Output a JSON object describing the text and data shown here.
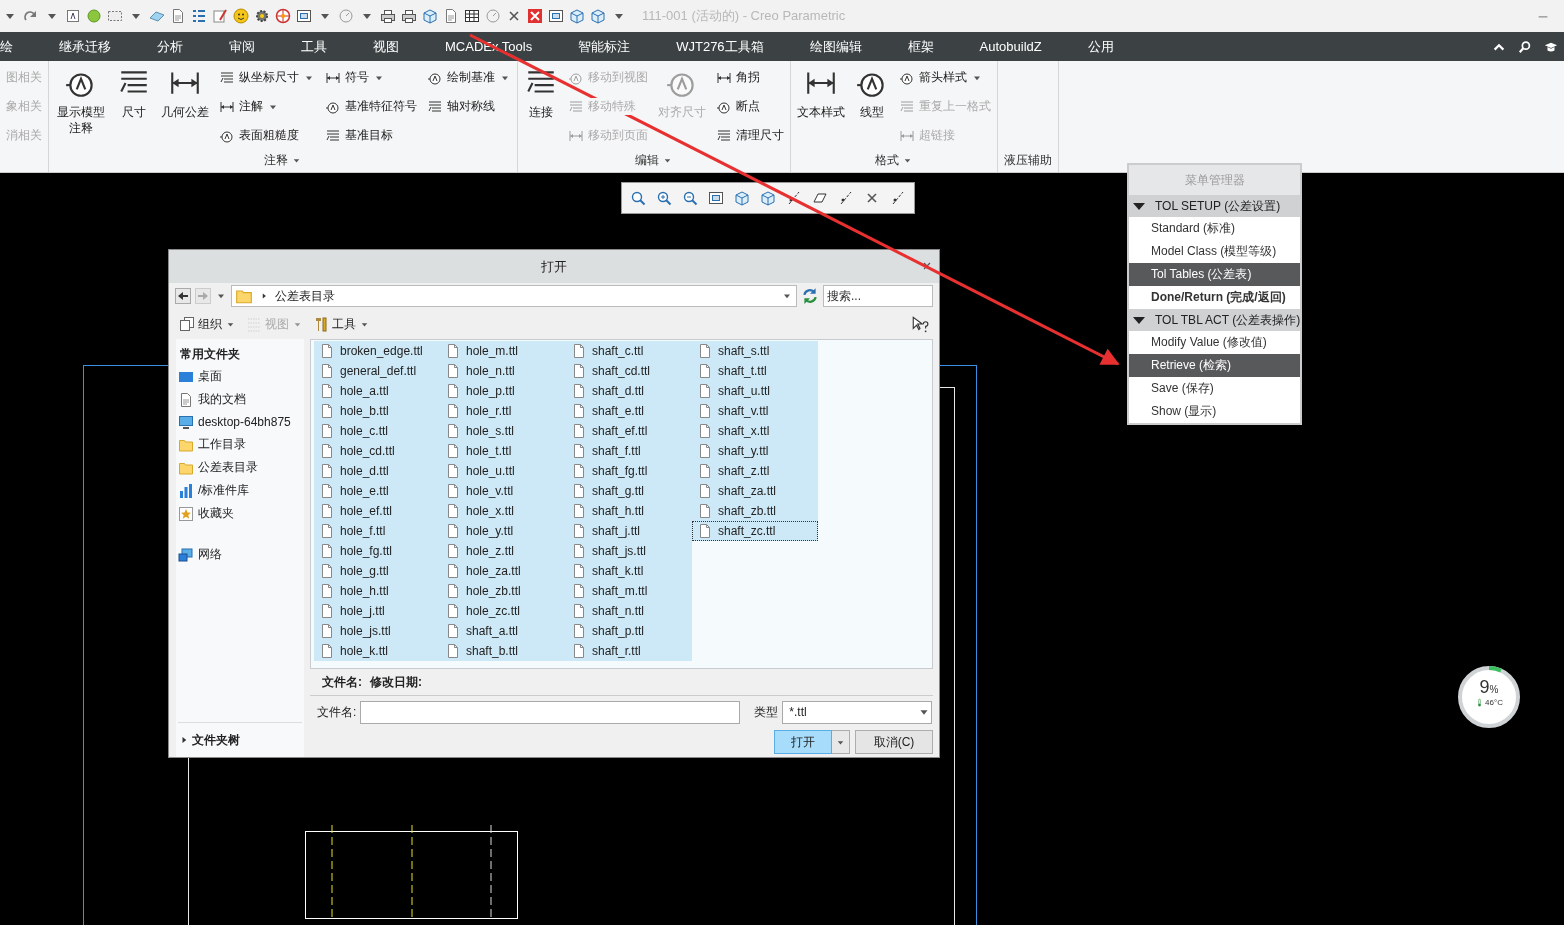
{
  "quick_access": {
    "title": "111-001 (活动的) - Creo Parametric"
  },
  "menu_tabs": [
    {
      "label": "绘"
    },
    {
      "label": "继承迁移"
    },
    {
      "label": "分析"
    },
    {
      "label": "审阅"
    },
    {
      "label": "工具"
    },
    {
      "label": "视图"
    },
    {
      "label": "MCADEx Tools"
    },
    {
      "label": "智能标注"
    },
    {
      "label": "WJT276工具箱"
    },
    {
      "label": "绘图编辑"
    },
    {
      "label": "框架"
    },
    {
      "label": "AutobuildZ"
    },
    {
      "label": "公用"
    }
  ],
  "ribbon": [
    {
      "columns": [
        {
          "kind": "text",
          "items": [
            {
              "label": "图相关",
              "disabled": true,
              "dropdown": false
            },
            {
              "label": "象相关",
              "disabled": true,
              "dropdown": false
            },
            {
              "label": "消相关",
              "disabled": true,
              "dropdown": false
            }
          ]
        }
      ]
    },
    {
      "title": "注释",
      "title_dropdown": true,
      "columns": [
        {
          "kind": "large",
          "items": [
            {
              "label": "显示模型注释",
              "disabled": false,
              "dropdown": false
            }
          ]
        },
        {
          "kind": "large",
          "items": [
            {
              "label": "尺寸",
              "disabled": false,
              "dropdown": false
            },
            {
              "label": "几何公差",
              "disabled": false,
              "dropdown": false
            }
          ]
        },
        {
          "kind": "stack",
          "items": [
            {
              "label": "纵坐标尺寸",
              "disabled": false,
              "dropdown": true
            },
            {
              "label": "注解",
              "disabled": false,
              "dropdown": true
            },
            {
              "label": "表面粗糙度",
              "disabled": false,
              "dropdown": false
            }
          ]
        },
        {
          "kind": "stack",
          "items": [
            {
              "label": "符号",
              "disabled": false,
              "dropdown": true
            },
            {
              "label": "基准特征符号",
              "disabled": false,
              "dropdown": false
            },
            {
              "label": "基准目标",
              "disabled": false,
              "dropdown": false
            }
          ]
        },
        {
          "kind": "stack",
          "items": [
            {
              "label": "绘制基准",
              "disabled": false,
              "dropdown": true
            },
            {
              "label": "轴对称线",
              "disabled": false,
              "dropdown": false
            }
          ]
        }
      ]
    },
    {
      "title": "编辑",
      "title_dropdown": true,
      "columns": [
        {
          "kind": "large",
          "items": [
            {
              "label": "连接",
              "disabled": false,
              "dropdown": false
            }
          ]
        },
        {
          "kind": "stack",
          "items": [
            {
              "label": "移动到视图",
              "disabled": true,
              "dropdown": false
            },
            {
              "label": "移动特殊",
              "disabled": true,
              "dropdown": false
            },
            {
              "label": "移动到页面",
              "disabled": true,
              "dropdown": false
            }
          ]
        },
        {
          "kind": "large",
          "items": [
            {
              "label": "对齐尺寸",
              "disabled": true,
              "dropdown": false
            }
          ]
        },
        {
          "kind": "stack",
          "items": [
            {
              "label": "角拐",
              "disabled": false,
              "dropdown": false
            },
            {
              "label": "断点",
              "disabled": false,
              "dropdown": false
            },
            {
              "label": "清理尺寸",
              "disabled": false,
              "dropdown": false
            }
          ]
        }
      ]
    },
    {
      "title": "格式",
      "title_dropdown": true,
      "columns": [
        {
          "kind": "large",
          "items": [
            {
              "label": "文本样式",
              "disabled": false,
              "dropdown": false
            },
            {
              "label": "线型",
              "disabled": false,
              "dropdown": false
            }
          ]
        },
        {
          "kind": "stack",
          "items": [
            {
              "label": "箭头样式",
              "disabled": false,
              "dropdown": true
            },
            {
              "label": "重复上一格式",
              "disabled": true,
              "dropdown": false
            },
            {
              "label": "超链接",
              "disabled": true,
              "dropdown": false
            }
          ]
        }
      ]
    },
    {
      "title": "液压辅助",
      "title_dropdown": false
    }
  ],
  "menu_manager": {
    "title": "菜单管理器",
    "sections": [
      {
        "label": "TOL SETUP (公差设置)",
        "expanded": true,
        "items": [
          {
            "label": "Standard (标准)",
            "selected": false,
            "bold": false
          },
          {
            "label": "Model Class (模型等级)",
            "selected": false,
            "bold": false
          },
          {
            "label": "Tol Tables (公差表)",
            "selected": true,
            "bold": false
          },
          {
            "label": "Done/Return (完成/返回)",
            "selected": false,
            "bold": true
          }
        ]
      },
      {
        "label": "TOL TBL ACT (公差表操作)",
        "expanded": true,
        "items": [
          {
            "label": "Modify Value (修改值)",
            "selected": false,
            "bold": false
          },
          {
            "label": "Retrieve (检索)",
            "selected": true,
            "bold": false
          },
          {
            "label": "Save (保存)",
            "selected": false,
            "bold": false
          },
          {
            "label": "Show (显示)",
            "selected": false,
            "bold": false
          }
        ]
      }
    ]
  },
  "dialog": {
    "title": "打开",
    "address": "公差表目录",
    "search": {
      "placeholder": "搜索..."
    },
    "toolbar": [
      {
        "label": "组织",
        "disabled": false
      },
      {
        "label": "视图",
        "disabled": true
      },
      {
        "label": "工具",
        "disabled": false
      }
    ],
    "sidebar": {
      "header": "常用文件夹",
      "groups": [
        [
          {
            "label": "桌面"
          },
          {
            "label": "我的文档"
          },
          {
            "label": "desktop-64bh875"
          },
          {
            "label": "工作目录"
          },
          {
            "label": "公差表目录"
          },
          {
            "label": "/标准件库"
          },
          {
            "label": "收藏夹"
          }
        ],
        [
          {
            "label": "网络"
          }
        ]
      ],
      "footer": "文件夹树"
    },
    "files": [
      {
        "name": "broken_edge.ttl",
        "selected": true,
        "focused": false
      },
      {
        "name": "general_def.ttl",
        "selected": true,
        "focused": false
      },
      {
        "name": "hole_a.ttl",
        "selected": true,
        "focused": false
      },
      {
        "name": "hole_b.ttl",
        "selected": true,
        "focused": false
      },
      {
        "name": "hole_c.ttl",
        "selected": true,
        "focused": false
      },
      {
        "name": "hole_cd.ttl",
        "selected": true,
        "focused": false
      },
      {
        "name": "hole_d.ttl",
        "selected": true,
        "focused": false
      },
      {
        "name": "hole_e.ttl",
        "selected": true,
        "focused": false
      },
      {
        "name": "hole_ef.ttl",
        "selected": true,
        "focused": false
      },
      {
        "name": "hole_f.ttl",
        "selected": true,
        "focused": false
      },
      {
        "name": "hole_fg.ttl",
        "selected": true,
        "focused": false
      },
      {
        "name": "hole_g.ttl",
        "selected": true,
        "focused": false
      },
      {
        "name": "hole_h.ttl",
        "selected": true,
        "focused": false
      },
      {
        "name": "hole_j.ttl",
        "selected": true,
        "focused": false
      },
      {
        "name": "hole_js.ttl",
        "selected": true,
        "focused": false
      },
      {
        "name": "hole_k.ttl",
        "selected": true,
        "focused": false
      },
      {
        "name": "hole_m.ttl",
        "selected": true,
        "focused": false
      },
      {
        "name": "hole_n.ttl",
        "selected": true,
        "focused": false
      },
      {
        "name": "hole_p.ttl",
        "selected": true,
        "focused": false
      },
      {
        "name": "hole_r.ttl",
        "selected": true,
        "focused": false
      },
      {
        "name": "hole_s.ttl",
        "selected": true,
        "focused": false
      },
      {
        "name": "hole_t.ttl",
        "selected": true,
        "focused": false
      },
      {
        "name": "hole_u.ttl",
        "selected": true,
        "focused": false
      },
      {
        "name": "hole_v.ttl",
        "selected": true,
        "focused": false
      },
      {
        "name": "hole_x.ttl",
        "selected": true,
        "focused": false
      },
      {
        "name": "hole_y.ttl",
        "selected": true,
        "focused": false
      },
      {
        "name": "hole_z.ttl",
        "selected": true,
        "focused": false
      },
      {
        "name": "hole_za.ttl",
        "selected": true,
        "focused": false
      },
      {
        "name": "hole_zb.ttl",
        "selected": true,
        "focused": false
      },
      {
        "name": "hole_zc.ttl",
        "selected": true,
        "focused": false
      },
      {
        "name": "shaft_a.ttl",
        "selected": true,
        "focused": false
      },
      {
        "name": "shaft_b.ttl",
        "selected": true,
        "focused": false
      },
      {
        "name": "shaft_c.ttl",
        "selected": true,
        "focused": false
      },
      {
        "name": "shaft_cd.ttl",
        "selected": true,
        "focused": false
      },
      {
        "name": "shaft_d.ttl",
        "selected": true,
        "focused": false
      },
      {
        "name": "shaft_e.ttl",
        "selected": true,
        "focused": false
      },
      {
        "name": "shaft_ef.ttl",
        "selected": true,
        "focused": false
      },
      {
        "name": "shaft_f.ttl",
        "selected": true,
        "focused": false
      },
      {
        "name": "shaft_fg.ttl",
        "selected": true,
        "focused": false
      },
      {
        "name": "shaft_g.ttl",
        "selected": true,
        "focused": false
      },
      {
        "name": "shaft_h.ttl",
        "selected": true,
        "focused": false
      },
      {
        "name": "shaft_j.ttl",
        "selected": true,
        "focused": false
      },
      {
        "name": "shaft_js.ttl",
        "selected": true,
        "focused": false
      },
      {
        "name": "shaft_k.ttl",
        "selected": true,
        "focused": false
      },
      {
        "name": "shaft_m.ttl",
        "selected": true,
        "focused": false
      },
      {
        "name": "shaft_n.ttl",
        "selected": true,
        "focused": false
      },
      {
        "name": "shaft_p.ttl",
        "selected": true,
        "focused": false
      },
      {
        "name": "shaft_r.ttl",
        "selected": true,
        "focused": false
      },
      {
        "name": "shaft_s.ttl",
        "selected": true,
        "focused": false
      },
      {
        "name": "shaft_t.ttl",
        "selected": true,
        "focused": false
      },
      {
        "name": "shaft_u.ttl",
        "selected": true,
        "focused": false
      },
      {
        "name": "shaft_v.ttl",
        "selected": true,
        "focused": false
      },
      {
        "name": "shaft_x.ttl",
        "selected": true,
        "focused": false
      },
      {
        "name": "shaft_y.ttl",
        "selected": true,
        "focused": false
      },
      {
        "name": "shaft_z.ttl",
        "selected": true,
        "focused": false
      },
      {
        "name": "shaft_za.ttl",
        "selected": true,
        "focused": false
      },
      {
        "name": "shaft_zb.ttl",
        "selected": true,
        "focused": false
      },
      {
        "name": "shaft_zc.ttl",
        "selected": true,
        "focused": true
      }
    ],
    "details": {
      "name_label": "文件名:",
      "date_label": "修改日期:"
    },
    "filename": {
      "label": "文件名:"
    },
    "type": {
      "label": "类型",
      "value": "*.ttl"
    },
    "buttons": [
      {
        "label": "打开",
        "kind": "primary"
      },
      {
        "label": "取消(C)",
        "kind": "secondary"
      }
    ]
  },
  "monitor": {
    "percent": "9",
    "unit": "%",
    "temperature": "46°C"
  }
}
